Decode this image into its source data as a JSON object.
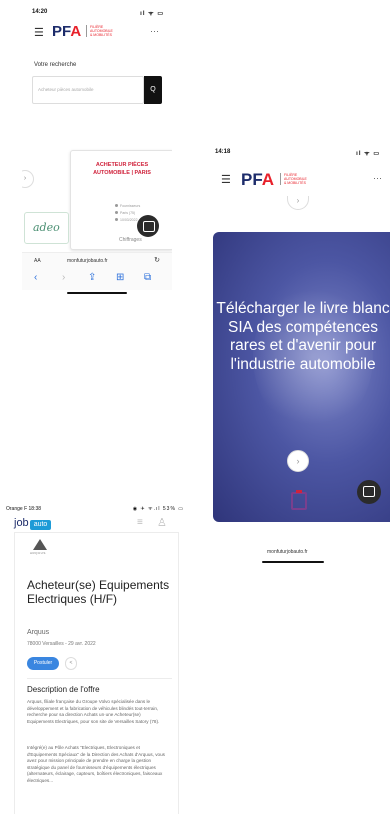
{
  "phone1": {
    "status_time": "14:20",
    "status_icons": "ıl ᯤ ▭",
    "brand": {
      "logo_main": "PF",
      "logo_accent": "A",
      "tagline": [
        "FILIÈRE",
        "AUTOMOBILE",
        "& MOBILITÉS"
      ]
    },
    "menu_icon": "☰",
    "more_icon": "···",
    "search": {
      "label": "Votre recherche",
      "placeholder": "Acheteur pièces automobile",
      "button_icon": "Q"
    },
    "job_card": {
      "title": "ACHETEUR PIÈCES AUTOMOBILE | PARIS",
      "meta": [
        "Fournisseurs",
        "Paris (75)",
        "10/03/2022"
      ],
      "more": "Chiffrages"
    },
    "partner_logo": "adeo",
    "browser": {
      "aa": "AA",
      "url": "monfuturjobauto.fr",
      "reload": "↻"
    },
    "toolbar": {
      "back": "‹",
      "forward": "›",
      "share": "⇪",
      "bookmarks": "⊞",
      "tabs": "⧉"
    }
  },
  "phone2": {
    "status_time": "14:18",
    "status_icons": "ıl ᯤ ▭",
    "brand": {
      "logo_main": "PF",
      "logo_accent": "A",
      "tagline": [
        "FILIÈRE",
        "AUTOMOBILE",
        "& MOBILITÉS"
      ]
    },
    "menu_icon": "☰",
    "more_icon": "···",
    "hero_text": "Télécharger le livre blanc SIA des compétences rares et d'avenir pour l'industrie automobile",
    "next_icon": "›",
    "url": "monfuturjobauto.fr"
  },
  "phone3": {
    "status_left": "Orange F 18:38",
    "status_right": "◉ ✈ ᯤ.ıl 53% ▭",
    "logo_text": "job",
    "logo_badge": "auto",
    "menu_icon": "≡",
    "user_icon": "♙",
    "company_logo_text": "ARQUUS",
    "job_title": "Acheteur(se) Equipements Electriques (H/F)",
    "company": "Arquus",
    "location_date": "78000 Versailles - 29 avr. 2022",
    "apply_label": "Postuler",
    "share_icon": "<",
    "description_heading": "Description de l'offre",
    "paragraph1": "Arquus, filiale française du Groupe Volvo spécialisée dans le développement et la fabrication de véhicules blindés tout-terrain, recherche pour sa direction Achats un·une Acheteur(se) Equipements Electriques, pour son site de Versailles Satory (78).",
    "paragraph2": "Intégré(e) au Pôle Achats \"Electriques, Electroniques et d'Equipements Spéciaux\" de la Direction des Achats d'Arquus, vous avez pour mission principale de prendre en charge la gestion stratégique du panel de fournisseurs d'équipements électriques (alternateurs, éclairage, capteurs, boîtiers électroniques, faisceaux électriques..."
  }
}
